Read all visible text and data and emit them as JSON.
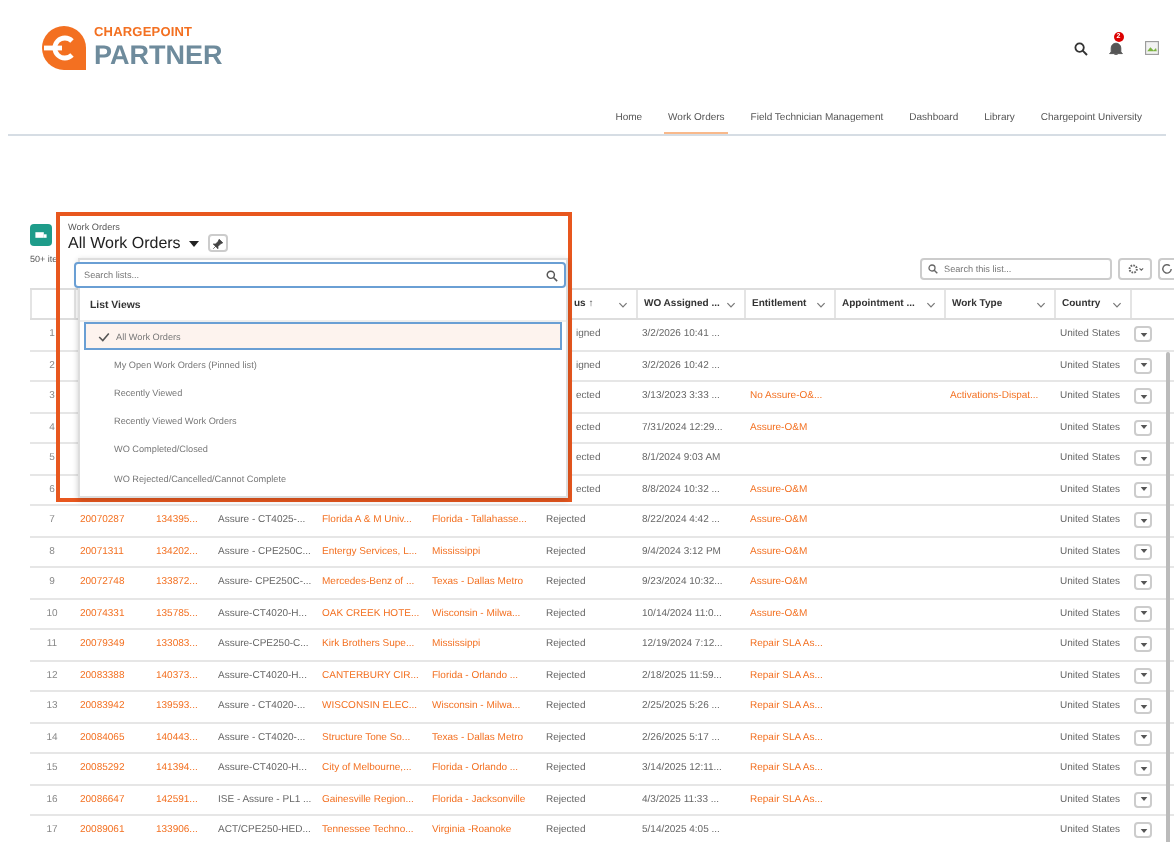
{
  "brand": {
    "line1": "CHARGEPOINT",
    "line2": "PARTNER"
  },
  "notifications": {
    "count": "2"
  },
  "nav": [
    {
      "label": "Home",
      "selected": false
    },
    {
      "label": "Work Orders",
      "selected": true
    },
    {
      "label": "Field Technician Management",
      "selected": false
    },
    {
      "label": "Dashboard",
      "selected": false
    },
    {
      "label": "Library",
      "selected": false
    },
    {
      "label": "Chargepoint University",
      "selected": false
    }
  ],
  "list": {
    "item_count": "50+ ite",
    "search": {
      "placeholder": "Search this list..."
    }
  },
  "picker": {
    "object": "Work Orders",
    "title": "All Work Orders",
    "search": {
      "placeholder": "Search lists..."
    },
    "section": "List Views",
    "views": [
      {
        "label": "All Work Orders",
        "selected": true
      },
      {
        "label": "My Open Work Orders (Pinned list)",
        "selected": false
      },
      {
        "label": "Recently Viewed",
        "selected": false
      },
      {
        "label": "Recently Viewed Work Orders",
        "selected": false
      },
      {
        "label": "WO Completed/Closed",
        "selected": false
      },
      {
        "label": "WO Rejected/Cancelled/Cannot Complete",
        "selected": false
      }
    ]
  },
  "table": {
    "headers": [
      "us ↑",
      "WO Assigned ...",
      "Entitlement",
      "Appointment ...",
      "Work Type",
      "Country"
    ],
    "rows": [
      {
        "row_number": "1",
        "status": "igned",
        "wo_assigned": "3/2/2026 10:41 ...",
        "country": "United States"
      },
      {
        "row_number": "2",
        "status": "igned",
        "wo_assigned": "3/2/2026 10:42 ...",
        "country": "United States"
      },
      {
        "row_number": "3",
        "status": "ected",
        "wo_assigned": "3/13/2023 3:33 ...",
        "entitlement": "No Assure-O&...",
        "work_type": "Activations-Dispat...",
        "country": "United States"
      },
      {
        "row_number": "4",
        "status": "ected",
        "wo_assigned": "7/31/2024 12:29...",
        "entitlement": "Assure-O&M",
        "country": "United States"
      },
      {
        "row_number": "5",
        "status": "ected",
        "wo_assigned": "8/1/2024 9:03 AM",
        "country": "United States"
      },
      {
        "row_number": "6",
        "status": "ected",
        "wo_assigned": "8/8/2024 10:32 ...",
        "entitlement": "Assure-O&M",
        "country": "United States"
      },
      {
        "row_number": "7",
        "work_order": "20070287",
        "column_3": "134395...",
        "column_4": "Assure - CT4025-...",
        "column_5": "Florida A & M Univ...",
        "column_6": "Florida - Tallahasse...",
        "status": "Rejected",
        "wo_assigned": "8/22/2024 4:42 ...",
        "entitlement": "Assure-O&M",
        "country": "United States"
      },
      {
        "row_number": "8",
        "work_order": "20071311",
        "column_3": "134202...",
        "column_4": "Assure - CPE250C...",
        "column_5": "Entergy Services, L...",
        "column_6": "Mississippi",
        "status": "Rejected",
        "wo_assigned": "9/4/2024 3:12 PM",
        "entitlement": "Assure-O&M",
        "country": "United States"
      },
      {
        "row_number": "9",
        "work_order": "20072748",
        "column_3": "133872...",
        "column_4": "Assure- CPE250C-...",
        "column_5": "Mercedes-Benz of ...",
        "column_6": "Texas - Dallas Metro",
        "status": "Rejected",
        "wo_assigned": "9/23/2024 10:32...",
        "entitlement": "Assure-O&M",
        "country": "United States"
      },
      {
        "row_number": "10",
        "work_order": "20074331",
        "column_3": "135785...",
        "column_4": "Assure-CT4020-H...",
        "column_5": "OAK CREEK HOTE...",
        "column_6": "Wisconsin - Milwa...",
        "status": "Rejected",
        "wo_assigned": "10/14/2024 11:0...",
        "entitlement": "Assure-O&M",
        "country": "United States"
      },
      {
        "row_number": "11",
        "work_order": "20079349",
        "column_3": "133083...",
        "column_4": "Assure-CPE250-C...",
        "column_5": "Kirk Brothers Supe...",
        "column_6": "Mississippi",
        "status": "Rejected",
        "wo_assigned": "12/19/2024 7:12...",
        "entitlement": "Repair SLA As...",
        "country": "United States"
      },
      {
        "row_number": "12",
        "work_order": "20083388",
        "column_3": "140373...",
        "column_4": "Assure-CT4020-H...",
        "column_5": "CANTERBURY CIR...",
        "column_6": "Florida - Orlando ...",
        "status": "Rejected",
        "wo_assigned": "2/18/2025 11:59...",
        "entitlement": "Repair SLA As...",
        "country": "United States"
      },
      {
        "row_number": "13",
        "work_order": "20083942",
        "column_3": "139593...",
        "column_4": "Assure - CT4020-...",
        "column_5": "WISCONSIN ELEC...",
        "column_6": "Wisconsin - Milwa...",
        "status": "Rejected",
        "wo_assigned": "2/25/2025 5:26 ...",
        "entitlement": "Repair SLA As...",
        "country": "United States"
      },
      {
        "row_number": "14",
        "work_order": "20084065",
        "column_3": "140443...",
        "column_4": "Assure - CT4020-...",
        "column_5": "Structure Tone So...",
        "column_6": "Texas - Dallas Metro",
        "status": "Rejected",
        "wo_assigned": "2/26/2025 5:17 ...",
        "entitlement": "Repair SLA As...",
        "country": "United States"
      },
      {
        "row_number": "15",
        "work_order": "20085292",
        "column_3": "141394...",
        "column_4": "Assure-CT4020-H...",
        "column_5": "City of Melbourne,...",
        "column_6": "Florida - Orlando ...",
        "status": "Rejected",
        "wo_assigned": "3/14/2025 12:11...",
        "entitlement": "Repair SLA As...",
        "country": "United States"
      },
      {
        "row_number": "16",
        "work_order": "20086647",
        "column_3": "142591...",
        "column_4": "ISE - Assure - PL1 ...",
        "column_5": "Gainesville Region...",
        "column_6": "Florida - Jacksonville",
        "status": "Rejected",
        "wo_assigned": "4/3/2025 11:33 ...",
        "entitlement": "Repair SLA As...",
        "country": "United States"
      },
      {
        "row_number": "17",
        "work_order": "20089061",
        "column_3": "133906...",
        "column_4": "ACT/CPE250-HED...",
        "column_5": "Tennessee Techno...",
        "column_6": "Virginia -Roanoke",
        "status": "Rejected",
        "wo_assigned": "5/14/2025 4:05 ...",
        "country": "United States"
      }
    ]
  }
}
